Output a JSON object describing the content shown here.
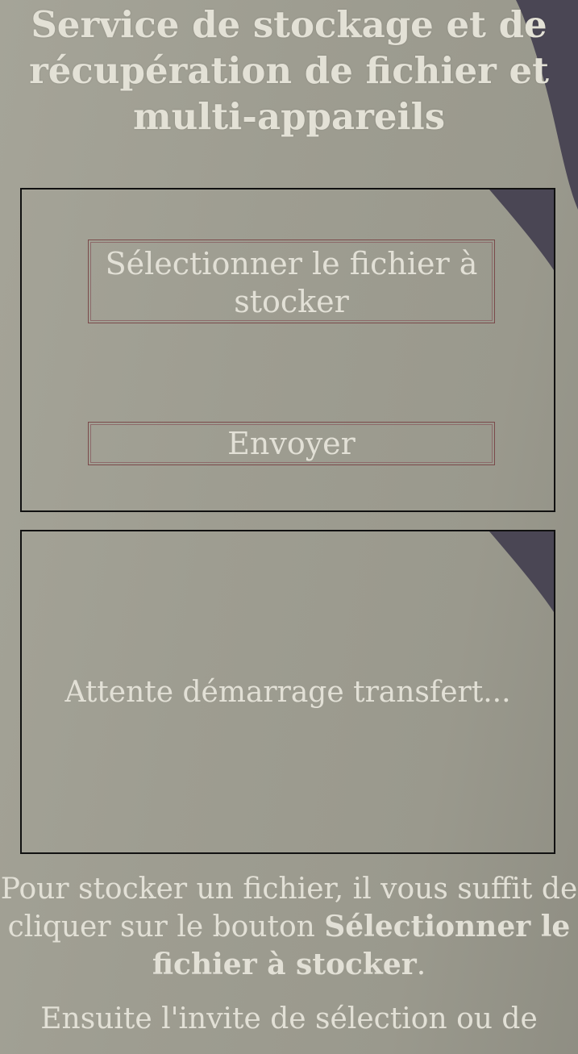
{
  "header": {
    "title": "Service de stockage et de récupération de fichier et multi-appareils"
  },
  "upload_form": {
    "select_button_label": "Sélectionner le fichier à stocker",
    "send_button_label": "Envoyer"
  },
  "status_panel": {
    "status_text": "Attente démarrage transfert..."
  },
  "instructions": {
    "paragraph1_text_before": "Pour stocker un fichier, il vous suffit de cliquer sur le bouton",
    "paragraph1_bold": "Sélectionner le fichier à stocker",
    "paragraph1_text_after": ".",
    "paragraph2_text": "Ensuite l'invite de sélection ou de"
  },
  "colors": {
    "background": "#9e9d91",
    "text": "#e2e0d6",
    "panel_border": "#111111",
    "button_border": "#7a4a4a",
    "curtain": "#4a4654"
  }
}
